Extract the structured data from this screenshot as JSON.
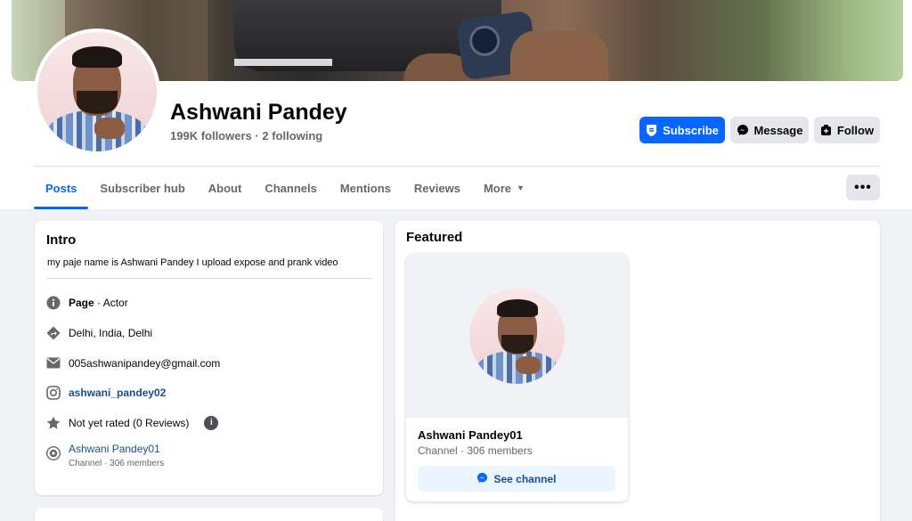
{
  "profile": {
    "name": "Ashwani Pandey",
    "followers": "199K followers",
    "separator": "·",
    "following": "2 following"
  },
  "actions": {
    "subscribe": "Subscribe",
    "message": "Message",
    "follow": "Follow",
    "more_dots": "•••"
  },
  "tabs": [
    {
      "label": "Posts",
      "active": true
    },
    {
      "label": "Subscriber hub"
    },
    {
      "label": "About"
    },
    {
      "label": "Channels"
    },
    {
      "label": "Mentions"
    },
    {
      "label": "Reviews"
    },
    {
      "label": "More"
    }
  ],
  "intro": {
    "title": "Intro",
    "bio": "my paje name is Ashwani Pandey  I upload expose and prank video",
    "page_label": "Page",
    "page_sep": " · ",
    "category": "Actor",
    "location": "Delhi, India, Delhi",
    "email": "005ashwanipandey@gmail.com",
    "instagram": "ashwani_pandey02",
    "rating": "Not yet rated (0 Reviews)",
    "info_glyph": "i",
    "channel_name": "Ashwani Pandey01",
    "channel_meta": "Channel · 306 members"
  },
  "featured": {
    "title": "Featured",
    "channel_name": "Ashwani Pandey01",
    "channel_meta": "Channel · 306 members",
    "button": "See channel"
  },
  "colors": {
    "accent": "#0866ff",
    "link": "#1a4e8c",
    "secondary_text": "#65676b",
    "button_gray": "#e4e6eb"
  },
  "icons": [
    "shield-icon",
    "messenger-icon",
    "follow-icon",
    "info-icon",
    "directions-icon",
    "mail-icon",
    "instagram-icon",
    "star-icon",
    "channel-icon",
    "caret-down-icon"
  ]
}
